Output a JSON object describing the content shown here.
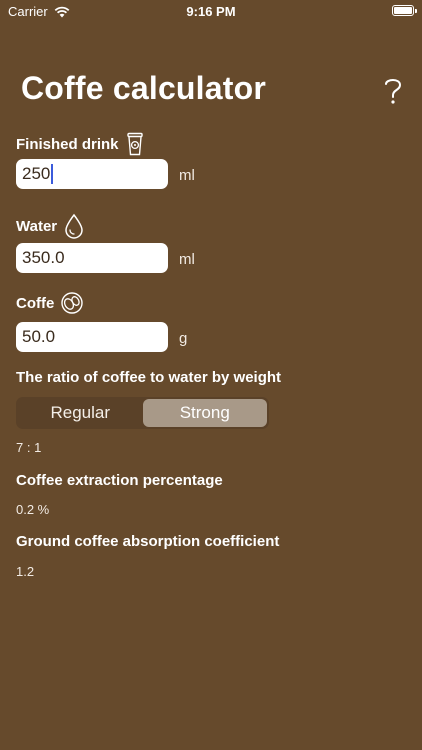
{
  "status": {
    "carrier": "Carrier",
    "time": "9:16 PM"
  },
  "title": "Coffe calculator",
  "finished": {
    "label": "Finished drink",
    "value": "250",
    "unit": "ml"
  },
  "water": {
    "label": "Water",
    "value": "350.0",
    "unit": "ml"
  },
  "coffee": {
    "label": "Coffe",
    "value": "50.0",
    "unit": "g"
  },
  "ratio": {
    "label": "The ratio of coffee to water by weight",
    "options": [
      "Regular",
      "Strong"
    ],
    "selected": "Strong",
    "value": "7 : 1"
  },
  "extraction": {
    "label": "Coffee extraction percentage",
    "value": "0.2 %"
  },
  "absorption": {
    "label": "Ground coffee absorption coefficient",
    "value": "1.2"
  },
  "colors": {
    "background": "#664a2c",
    "segment_active": "#a89988",
    "caret": "#3b5bdb"
  }
}
